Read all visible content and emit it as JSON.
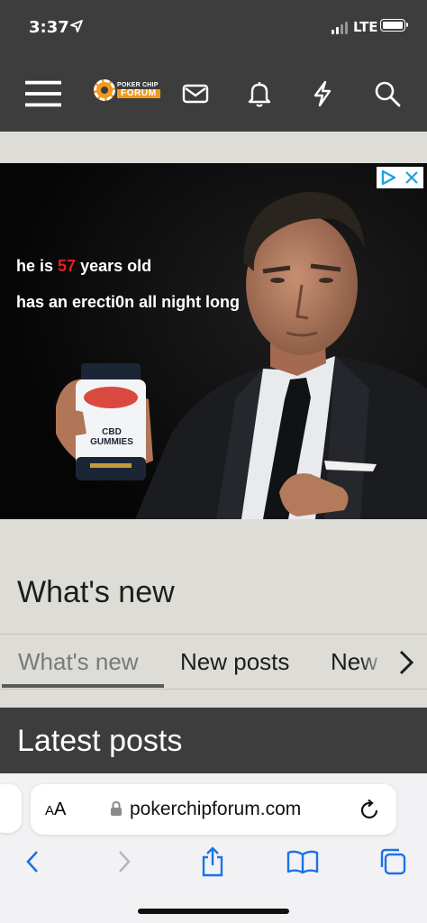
{
  "status_bar": {
    "time": "3:37",
    "network": "LTE"
  },
  "navbar": {
    "logo_top": "POKER CHIP",
    "logo_bottom": "FORUM",
    "icons": [
      "menu-icon",
      "mail-icon",
      "bell-icon",
      "bolt-icon",
      "search-icon"
    ]
  },
  "ad": {
    "line1_prefix": "he is ",
    "line1_number": "57",
    "line1_suffix": " years old",
    "line2": "has an erecti0n all night long",
    "product_line1": "CBD",
    "product_line2": "GUMMIES",
    "accent_color": "#e02020"
  },
  "page": {
    "title": "What's new",
    "tabs": [
      {
        "label": "What's new",
        "active": true
      },
      {
        "label": "New posts",
        "active": false
      },
      {
        "label": "New",
        "active": false
      }
    ],
    "latest_title": "Latest posts"
  },
  "safari": {
    "aa_label_small": "A",
    "aa_label_large": "A",
    "url": "pokerchipforum.com"
  },
  "colors": {
    "nav_bg": "#3d3d3d",
    "page_bg": "#dddcd6",
    "brand_orange": "#f29a1f",
    "safari_blue": "#1a73e8"
  }
}
